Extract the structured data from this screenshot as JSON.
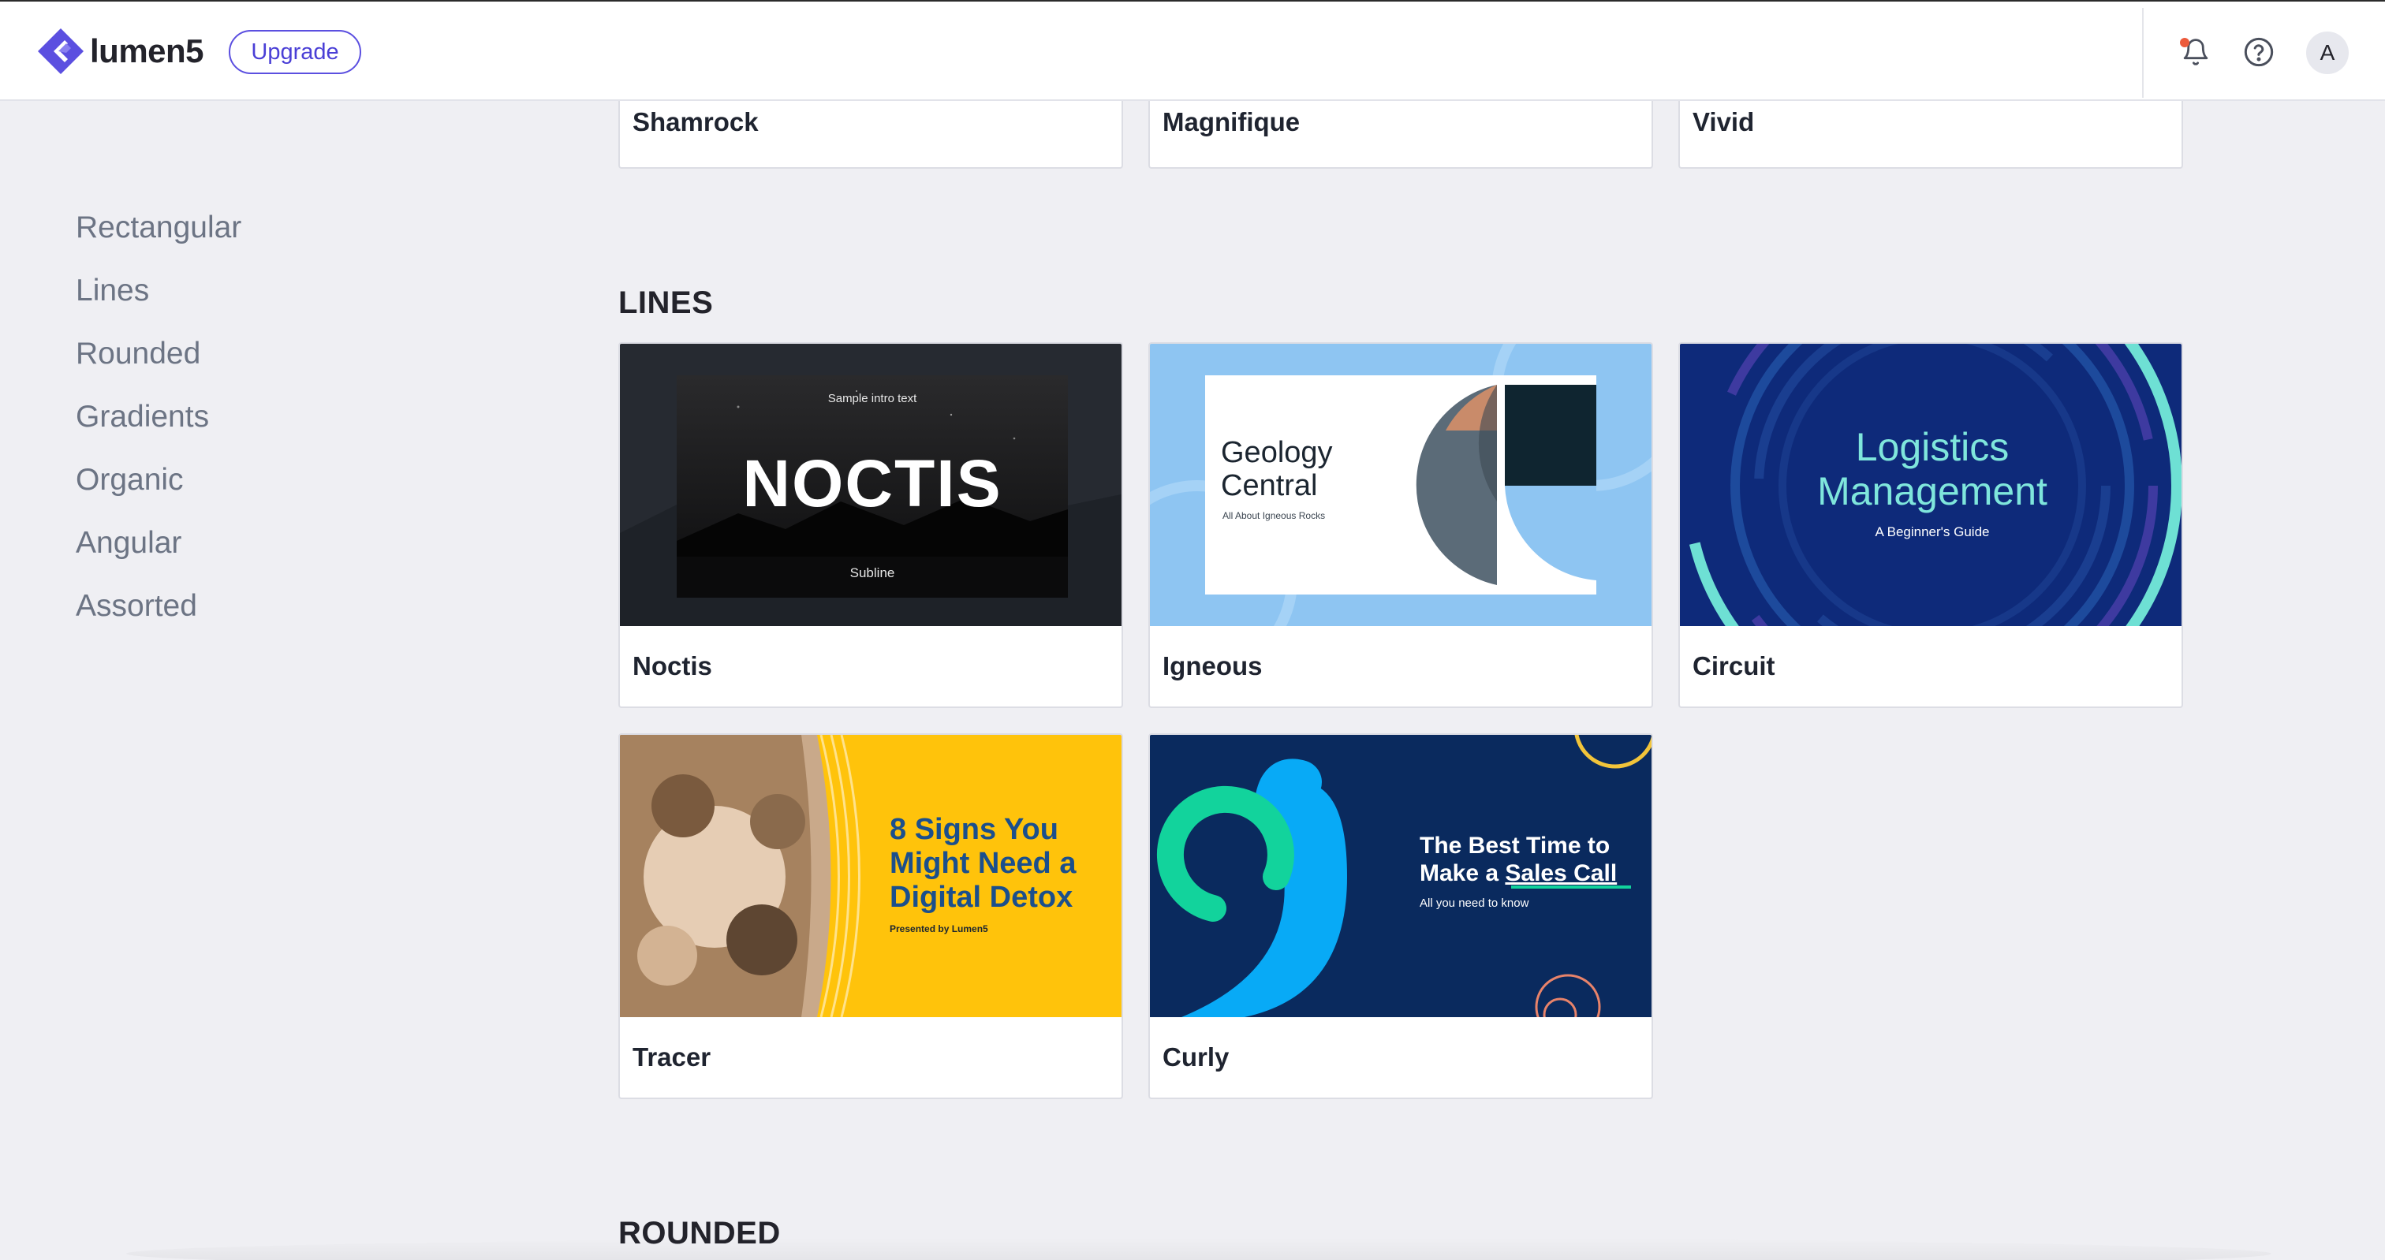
{
  "header": {
    "logo_text": "lumen5",
    "upgrade_label": "Upgrade",
    "avatar_initial": "A",
    "icons": [
      "logo-icon",
      "bell-icon",
      "help-icon"
    ],
    "accent_color": "#5b4fe0",
    "notification_dot_color": "#ec5a3b"
  },
  "sidebar": {
    "items": [
      {
        "label": "Rectangular"
      },
      {
        "label": "Lines"
      },
      {
        "label": "Rounded"
      },
      {
        "label": "Gradients"
      },
      {
        "label": "Organic"
      },
      {
        "label": "Angular"
      },
      {
        "label": "Assorted"
      }
    ]
  },
  "sections": {
    "rectangular_partial": [
      {
        "name": "Shamrock"
      },
      {
        "name": "Magnifique"
      },
      {
        "name": "Vivid"
      }
    ],
    "lines": {
      "title": "LINES",
      "cards": [
        {
          "name": "Noctis",
          "thumb": {
            "top": "Sample intro text",
            "main": "NOCTIS",
            "sub": "Subline"
          }
        },
        {
          "name": "Igneous",
          "thumb": {
            "line1": "Geology",
            "line2": "Central",
            "sub": "All About Igneous Rocks"
          }
        },
        {
          "name": "Circuit",
          "thumb": {
            "line1": "Logistics",
            "line2": "Management",
            "sub": "A Beginner's Guide"
          }
        },
        {
          "name": "Tracer",
          "thumb": {
            "line1": "8 Signs You",
            "line2": "Might Need a",
            "line3": "Digital Detox",
            "sub": "Presented by Lumen5"
          }
        },
        {
          "name": "Curly",
          "thumb": {
            "line1": "The Best Time to",
            "line2a": "Make a ",
            "line2b": "Sales Call",
            "sub": "All you need to know"
          }
        }
      ]
    },
    "rounded": {
      "title": "ROUNDED"
    }
  }
}
